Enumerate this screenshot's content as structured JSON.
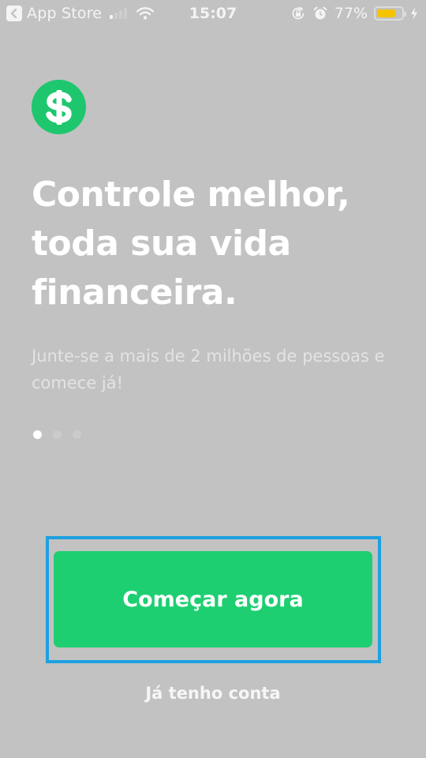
{
  "status_bar": {
    "back_app": "App Store",
    "time": "15:07",
    "battery_percent": "77%",
    "battery_level": 0.77,
    "signal_bars_active": 1,
    "signal_bars_total": 4,
    "icons": [
      "back-chevron-icon",
      "signal-icon",
      "wifi-icon",
      "rotation-lock-icon",
      "alarm-icon",
      "battery-icon",
      "charging-bolt-icon"
    ]
  },
  "brand": {
    "logo_icon": "dollar-sign-icon",
    "logo_glyph": "$",
    "accent_color": "#1ec76e"
  },
  "onboarding": {
    "headline_lines": [
      "Controle melhor,",
      "toda sua vida",
      "financeira."
    ],
    "subtitle": "Junte-se a mais de 2 milhões de pessoas e comece já!",
    "pages_total": 3,
    "current_page": 1
  },
  "actions": {
    "primary_label": "Começar agora",
    "primary_color": "#1ecf72",
    "highlight_color": "#1da0e0",
    "secondary_label": "Já tenho conta"
  }
}
